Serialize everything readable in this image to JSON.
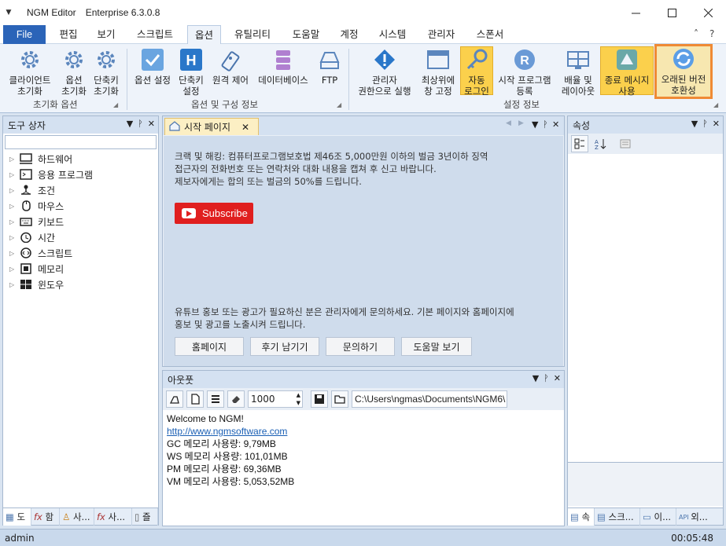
{
  "app": {
    "name": "NGM Editor",
    "edition": "Enterprise 6.3.0.8",
    "menu_glyph": "▼"
  },
  "window_controls": {
    "minimize": "─",
    "maximize": "☐",
    "close": "✕"
  },
  "tabs": [
    {
      "label": "File"
    },
    {
      "label": "편집"
    },
    {
      "label": "보기"
    },
    {
      "label": "스크립트"
    },
    {
      "label": "옵션"
    },
    {
      "label": "유틸리티"
    },
    {
      "label": "도움말"
    },
    {
      "label": "계정"
    },
    {
      "label": "시스템"
    },
    {
      "label": "관리자"
    },
    {
      "label": "스폰서"
    }
  ],
  "tabrow_controls": {
    "collapse": "˄",
    "help": "?"
  },
  "ribbon": {
    "buttons": [
      {
        "line1": "클라이언트",
        "line2": "초기화",
        "icon": "gear-icon"
      },
      {
        "line1": "옵션",
        "line2": "초기화",
        "icon": "gear-icon"
      },
      {
        "line1": "단축키",
        "line2": "초기화",
        "icon": "gear-icon"
      },
      {
        "line1": "옵션 설정",
        "line2": "",
        "icon": "checkbox-icon"
      },
      {
        "line1": "단축키",
        "line2": "설정",
        "icon": "hotkey-icon"
      },
      {
        "line1": "원격 제어",
        "line2": "",
        "icon": "remote-icon"
      },
      {
        "line1": "데이터베이스",
        "line2": "",
        "icon": "database-icon"
      },
      {
        "line1": "FTP",
        "line2": "",
        "icon": "ftp-icon"
      },
      {
        "line1": "관리자",
        "line2": "권한으로 실행",
        "icon": "shield-icon"
      },
      {
        "line1": "최상위에",
        "line2": "창 고정",
        "icon": "window-icon"
      },
      {
        "line1": "자동",
        "line2": "로그인",
        "icon": "key-icon"
      },
      {
        "line1": "시작 프로그램",
        "line2": "등록",
        "icon": "registry-icon"
      },
      {
        "line1": "배율 및",
        "line2": "레이아웃",
        "icon": "layout-icon"
      },
      {
        "line1": "종료 메시지",
        "line2": "사용",
        "icon": "message-icon"
      },
      {
        "line1": "오래된 버전",
        "line2": "호환성",
        "icon": "refresh-icon"
      }
    ],
    "groups": [
      "초기화 옵션",
      "옵션 및 구성 정보",
      "설정 정보"
    ]
  },
  "toolbox": {
    "title": "도구 상자",
    "items": [
      "하드웨어",
      "응용 프로그램",
      "조건",
      "마우스",
      "키보드",
      "시간",
      "스크립트",
      "메모리",
      "윈도우"
    ],
    "tabs": [
      "도",
      "함",
      "사...",
      "사...",
      "즐"
    ]
  },
  "panel_controls": {
    "dropdown": "▼",
    "pin": "ᚹ",
    "close": "✕"
  },
  "start_page": {
    "tab_label": "시작 페이지",
    "warning": [
      "크랙 및 해킹: 컴퓨터프로그램보호법 제46조 5,000만원 이하의 벌금 3년이하 징역",
      "접근자의 전화번호 또는 연락처와 대화 내용을 캡쳐 후 신고 바랍니다.",
      "제보자에게는 합의 또는 벌금의 50%를 드립니다."
    ],
    "subscribe": "Subscribe",
    "promo": [
      "유튜브 홍보 또는 광고가 필요하신 분은 관리자에게 문의하세요. 기본 페이지와 홈페이지에",
      "홍보 및 광고를 노출시켜 드립니다."
    ],
    "buttons": [
      "홈페이지",
      "후기 남기기",
      "문의하기",
      "도움말 보기"
    ]
  },
  "output": {
    "title": "아웃풋",
    "line_count": "1000",
    "path": "C:\\Users\\ngmas\\Documents\\NGM6\\",
    "lines": [
      "Welcome to NGM!",
      "http://www.ngmsoftware.com",
      "GC 메모리 사용량: 9,79MB",
      "WS 메모리 사용량: 101,01MB",
      "PM 메모리 사용량: 69,36MB",
      "VM 메모리 사용량: 5,053,52MB"
    ]
  },
  "properties": {
    "title": "속성",
    "tabs": [
      "속",
      "스크...",
      "이...",
      "외..."
    ]
  },
  "status": {
    "user": "admin",
    "time": "00:05:48"
  },
  "colors": {
    "file_tab": "#2b64b8",
    "highlight": "#fbd04c",
    "outline": "#ef8a35",
    "youtube": "#e01f1f"
  }
}
